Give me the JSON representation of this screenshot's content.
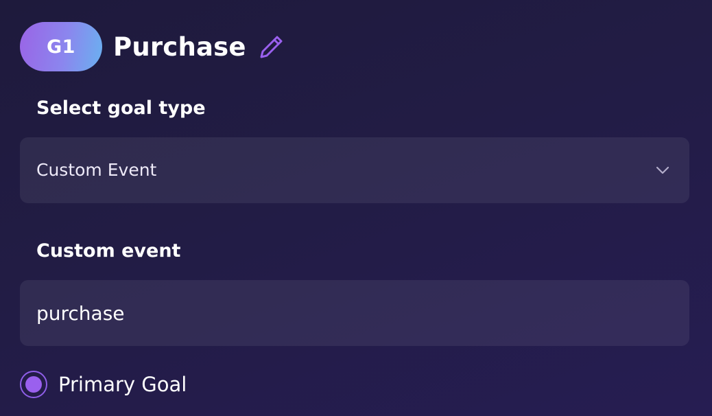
{
  "goal": {
    "badge": "G1",
    "title": "Purchase",
    "edit_icon": "pencil-icon"
  },
  "goal_type": {
    "label": "Select goal type",
    "value": "Custom Event",
    "chevron_icon": "chevron-down-icon"
  },
  "custom_event": {
    "label": "Custom event",
    "value": "purchase"
  },
  "primary_goal": {
    "label": "Primary Goal",
    "selected": true
  },
  "colors": {
    "accent": "#9a60ee",
    "badge_gradient_start": "#9a64e6",
    "badge_gradient_end": "#6ab1f0"
  }
}
